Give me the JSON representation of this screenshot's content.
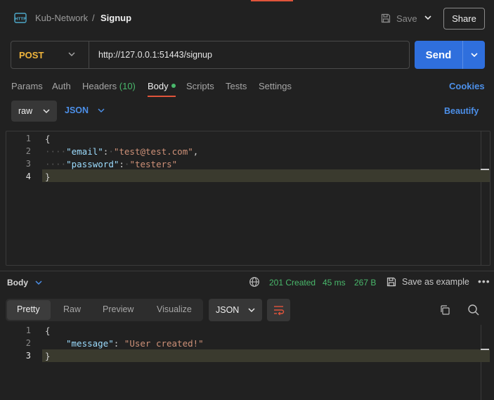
{
  "header": {
    "breadcrumb_parent": "Kub-Network",
    "breadcrumb_sep": "/",
    "title": "Signup",
    "save_label": "Save",
    "share_label": "Share"
  },
  "request": {
    "method": "POST",
    "url": "http://127.0.0.1:51443/signup",
    "send_label": "Send"
  },
  "request_tabs": {
    "params": "Params",
    "auth": "Auth",
    "headers": "Headers",
    "headers_count": "(10)",
    "body": "Body",
    "scripts": "Scripts",
    "tests": "Tests",
    "settings": "Settings",
    "cookies": "Cookies"
  },
  "body_mode": {
    "mode": "raw",
    "format": "JSON",
    "beautify": "Beautify"
  },
  "request_body": {
    "lines": [
      {
        "num": "1",
        "open": "{"
      },
      {
        "num": "2",
        "ws": "····",
        "key": "\"email\"",
        "colon": ":",
        "ws2": "·",
        "value": "\"test@test.com\"",
        "tail": ","
      },
      {
        "num": "3",
        "ws": "····",
        "key": "\"password\"",
        "colon": ":",
        "ws2": "·",
        "value": "\"testers\"",
        "tail": ""
      },
      {
        "num": "4",
        "close": "}"
      }
    ]
  },
  "response": {
    "section_label": "Body",
    "status": "201 Created",
    "time": "45 ms",
    "size": "267 B",
    "save_example": "Save as example",
    "more": "•••",
    "view_tabs": [
      "Pretty",
      "Raw",
      "Preview",
      "Visualize"
    ],
    "format": "JSON",
    "lines": [
      {
        "num": "1",
        "open": "{"
      },
      {
        "num": "2",
        "key": "\"message\"",
        "colon": ":",
        "value": "\"User created!\""
      },
      {
        "num": "3",
        "close": "}"
      }
    ]
  },
  "colors": {
    "accent_orange": "#e0543b",
    "send_blue": "#2f6fdd",
    "link_blue": "#4c8fe8",
    "status_green": "#49b86b",
    "method_yellow": "#f0b53c"
  }
}
